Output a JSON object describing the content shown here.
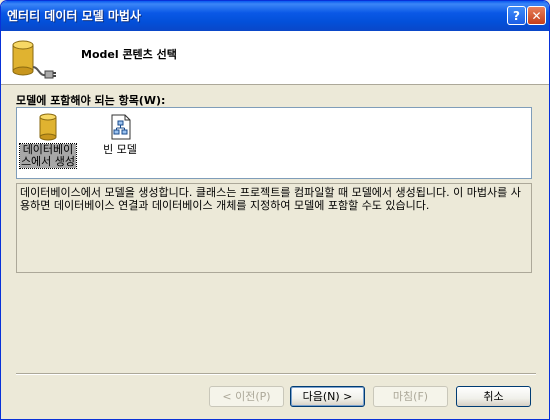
{
  "window": {
    "title": "엔터티 데이터 모델 마법사",
    "help_glyph": "?",
    "close_glyph": "✕"
  },
  "header": {
    "title": "Model 콘텐츠 선택",
    "icon": "database-plug-icon"
  },
  "section": {
    "label": "모델에 포함해야 되는 항목(W):"
  },
  "templates": [
    {
      "label_line1": "데이터베이",
      "label_line2": "스에서 생성",
      "icon": "database-icon",
      "selected": true
    },
    {
      "label_line1": "빈 모델",
      "label_line2": "",
      "icon": "empty-model-icon",
      "selected": false
    }
  ],
  "description": "데이터베이스에서 모델을 생성합니다. 클래스는 프로젝트를 컴파일할 때 모델에서 생성됩니다. 이 마법사를 사용하면 데이터베이스 연결과 데이터베이스 개체를 지정하여 모델에 포함할 수도 있습니다.",
  "buttons": {
    "prev": "< 이전(P)",
    "next": "다음(N) >",
    "finish": "마침(F)",
    "cancel": "취소"
  },
  "colors": {
    "titlebar": "#0a58e6",
    "dialog_bg": "#ece9d8",
    "selection": "#a7a7a7"
  }
}
